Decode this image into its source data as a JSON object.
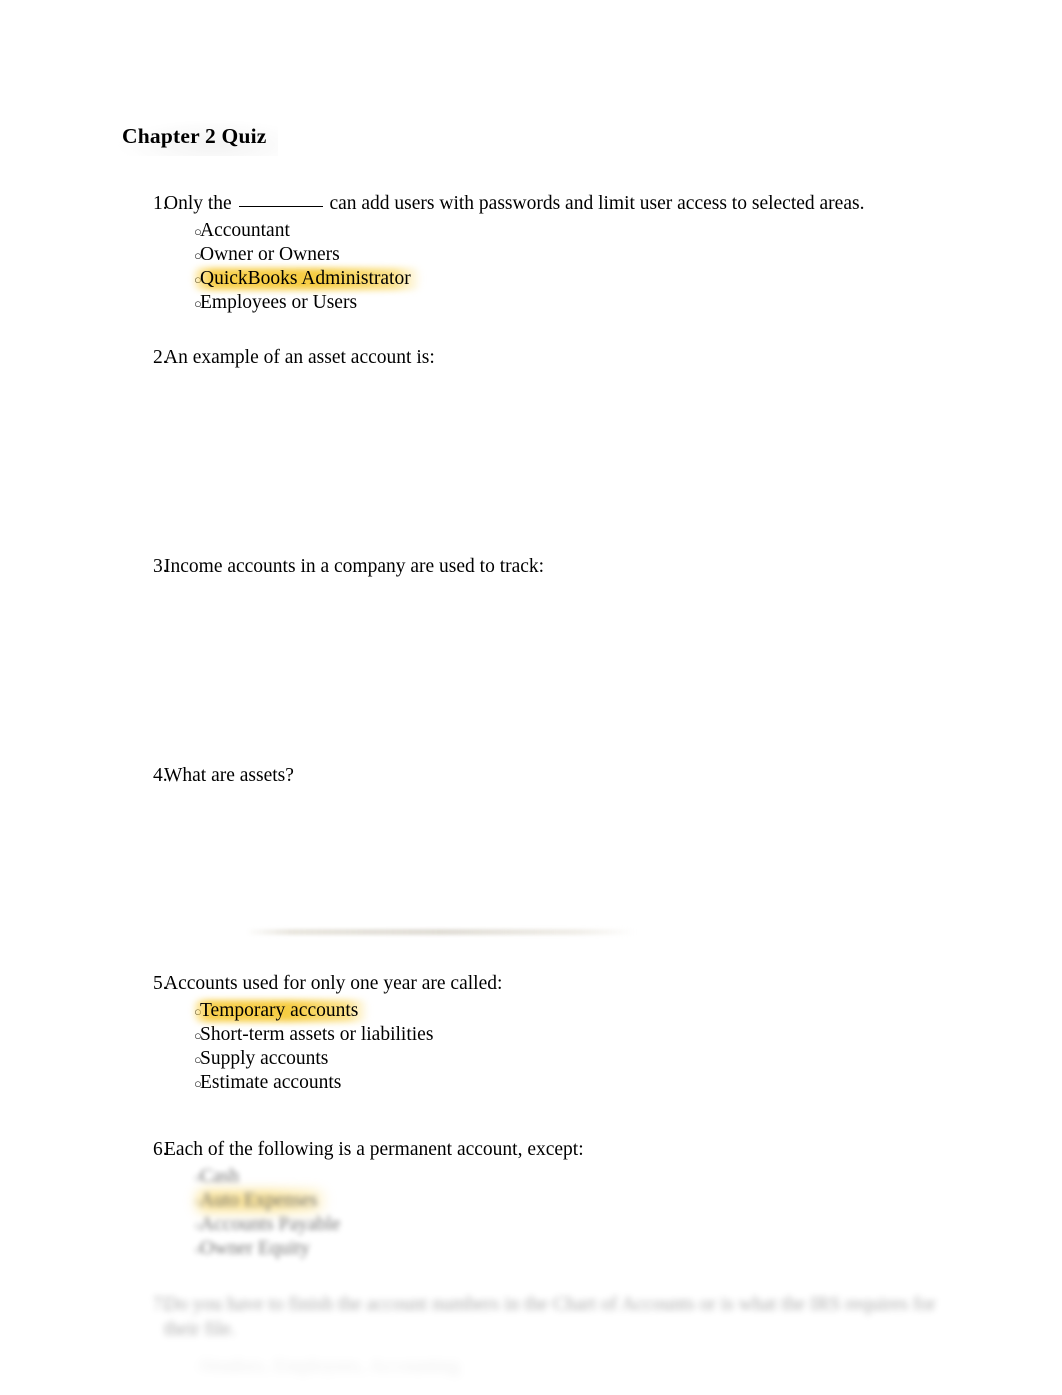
{
  "document": {
    "title": "Chapter 2 Quiz",
    "page_background": "#ffffff",
    "text_color": "#000000",
    "highlight_color": "#f6cb3c"
  },
  "questions": [
    {
      "number": "1.",
      "text_before_blank": "Only the",
      "text_after_blank": "can add users with passwords and limit user access to selected areas.",
      "has_blank": true,
      "bullet": "○",
      "options": [
        {
          "label": "Accountant",
          "highlighted": false
        },
        {
          "label": "Owner or Owners",
          "highlighted": false
        },
        {
          "label": "QuickBooks Administrator",
          "highlighted": true
        },
        {
          "label": "Employees or Users",
          "highlighted": false
        }
      ]
    },
    {
      "number": "2.",
      "text": "An example of an asset account is:",
      "options": []
    },
    {
      "number": "3.",
      "text": "Income accounts in a company are used to track:",
      "options": []
    },
    {
      "number": "4.",
      "text": "What are assets?",
      "options": []
    },
    {
      "number": "5.",
      "text": "Accounts used for only one year are called:",
      "bullet": "○",
      "options": [
        {
          "label": "Temporary accounts",
          "highlighted": true
        },
        {
          "label": "Short-term assets or liabilities",
          "highlighted": false
        },
        {
          "label": "Supply accounts",
          "highlighted": false
        },
        {
          "label": "Estimate accounts",
          "highlighted": false
        }
      ]
    },
    {
      "number": "6.",
      "text": "Each of the following is a permanent account, except:",
      "bullet": "○",
      "options": [
        {
          "label": "Cash",
          "highlighted": false
        },
        {
          "label": "Auto Expenses",
          "highlighted": true
        },
        {
          "label": "Accounts Payable",
          "highlighted": false
        },
        {
          "label": "Owner Equity",
          "highlighted": false
        }
      ]
    },
    {
      "number": "7.",
      "text": "Do you have to finish the account numbers in the Chart of Accounts or is what the IRS requires for their file.",
      "bullet": "○",
      "options": [
        {
          "label": "Vendors, Employees, Accounting",
          "highlighted": false
        }
      ]
    }
  ]
}
